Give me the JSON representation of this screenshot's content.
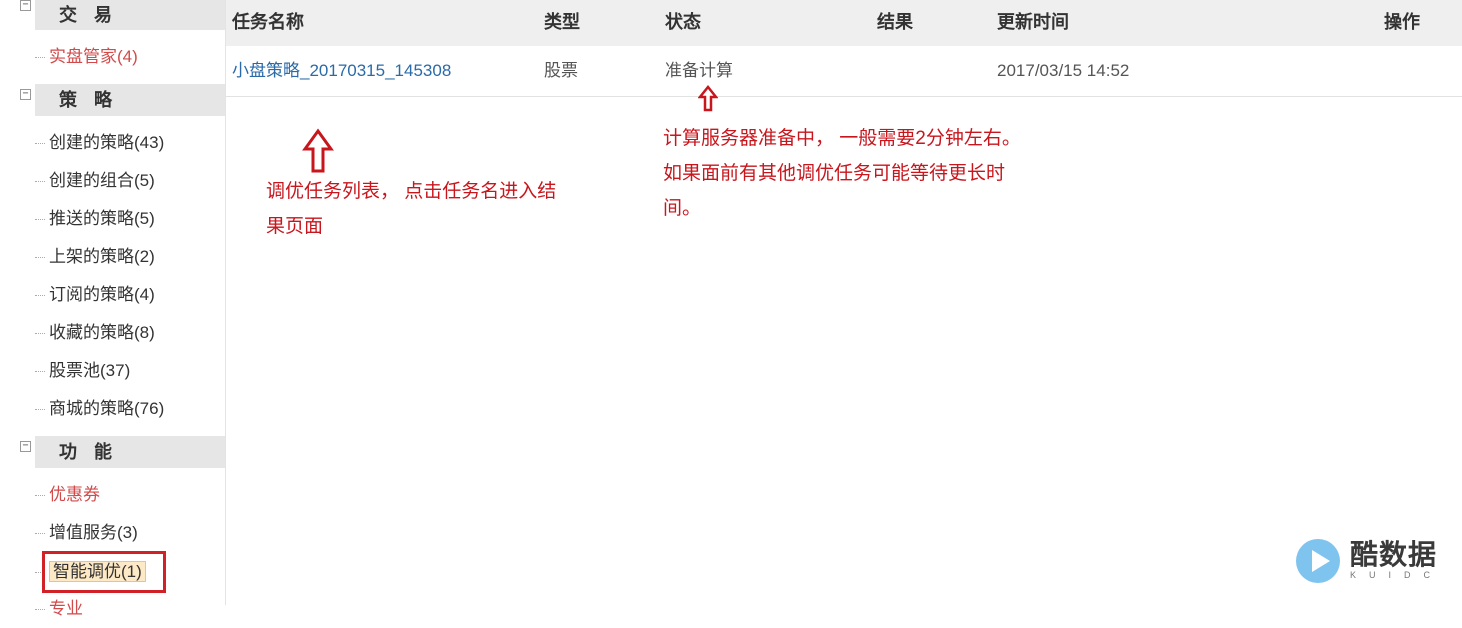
{
  "sidebar": {
    "sections": [
      {
        "title": "交 易",
        "toggle": "−"
      },
      {
        "title": "策 略",
        "toggle": "−"
      },
      {
        "title": "功 能",
        "toggle": "−"
      }
    ],
    "trade_items": [
      "实盘管家(4)"
    ],
    "strategy_items": [
      "创建的策略(43)",
      "创建的组合(5)",
      "推送的策略(5)",
      "上架的策略(2)",
      "订阅的策略(4)",
      "收藏的策略(8)",
      "股票池(37)",
      "商城的策略(76)"
    ],
    "function_items": [
      "优惠券",
      "增值服务(3)",
      "智能调优(1)",
      "专业"
    ],
    "colors": {
      "red_item": "#d24a4a",
      "highlight_border": "#d12026"
    }
  },
  "table": {
    "headers": [
      "任务名称",
      "类型",
      "状态",
      "结果",
      "更新时间",
      "操作"
    ],
    "rows": [
      {
        "name": "小盘策略_20170315_145308",
        "type": "股票",
        "status": "准备计算",
        "result": "",
        "updated": "2017/03/15 14:52",
        "action": ""
      }
    ]
  },
  "annotations": {
    "list_note_1": "调优任务列表， 点击任务名进入结",
    "list_note_2": "果页面",
    "status_note_1": "计算服务器准备中， 一般需要2分钟左右。",
    "status_note_2": "如果面前有其他调优任务可能等待更长时",
    "status_note_3": "间。",
    "color": "#c8161d"
  },
  "watermark": {
    "brand": "酷数据",
    "sub": "KUIDC"
  }
}
